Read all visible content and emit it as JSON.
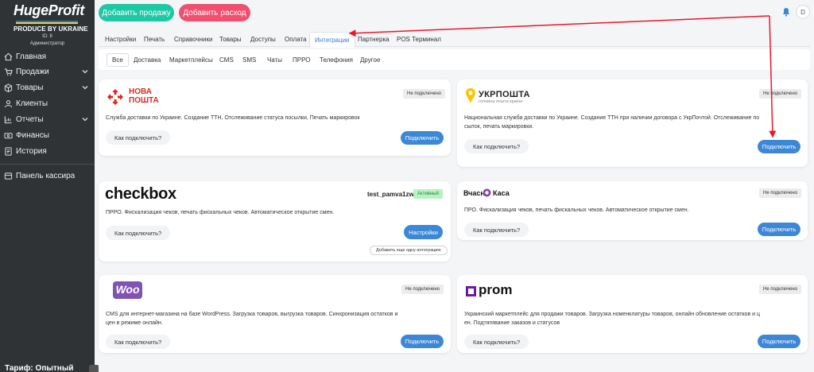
{
  "sidebar": {
    "brand": "HugeProfit",
    "brand_sub": "PRODUCE BY UKRAINE",
    "user_id": "ID: 8",
    "user_role": "Администратор",
    "items": [
      {
        "label": "Главная",
        "icon": "home-icon",
        "expandable": false
      },
      {
        "label": "Продажи",
        "icon": "cart-icon",
        "expandable": true
      },
      {
        "label": "Товары",
        "icon": "box-icon",
        "expandable": true
      },
      {
        "label": "Клиенты",
        "icon": "users-icon",
        "expandable": false
      },
      {
        "label": "Отчеты",
        "icon": "chart-icon",
        "expandable": true
      },
      {
        "label": "Финансы",
        "icon": "money-icon",
        "expandable": false
      },
      {
        "label": "История",
        "icon": "history-icon",
        "expandable": false
      },
      {
        "label": "Панель кассира",
        "icon": "cashier-icon",
        "expandable": false
      }
    ],
    "tariff": "Тариф: Опытный"
  },
  "topbar": {
    "add_sale": "Добавить продажу",
    "add_expense": "Добавить расход",
    "avatar_letter": "D",
    "colors": {
      "sale": "#1dc8a4",
      "expense": "#f0506e"
    }
  },
  "tabs": [
    "Настройки",
    "Печать",
    "Справочники",
    "Товары",
    "Доступы",
    "Оплата",
    "Интеграции",
    "Партнерка",
    "POS Терминал"
  ],
  "active_tab": "Интеграции",
  "subtabs": [
    "Все",
    "Доставка",
    "Маркетплейсы",
    "CMS",
    "SMS",
    "Чаты",
    "ПРРО",
    "Телефония",
    "Другое"
  ],
  "active_subtab": "Все",
  "cards": {
    "novaposhta": {
      "logo_line1": "НОВА",
      "logo_line2": "ПОШТА",
      "status": "Не подключено",
      "desc": "Служба доставки по Украине. Создание ТТН, Отслеживание статуса посылки, Печать маркировок",
      "how": "Как подключить?",
      "action": "Подключить"
    },
    "ukrposhta": {
      "logo": "УКРПОШТА",
      "logo_sub": "головна пошта країни",
      "status": "Не подключено",
      "desc_line1": "Национальная служба доставки по Украине. Создание ТТН при наличии договора с УкрПочтой. Отслеживание по",
      "desc_line2": "сылок, печать маркировки.",
      "how": "Как подключить?",
      "action": "Подключить"
    },
    "checkbox": {
      "logo": "checkbox",
      "account": "test_pamva1zwa",
      "status": "Активный",
      "desc": "ПРРО. Фискализация чеков, печать фискальных чеков. Автоматическое открытие смен.",
      "how": "Как подключить?",
      "action": "Настройки",
      "add_more": "Добавить еще одну интеграцию"
    },
    "vchasno": {
      "logo_a": "Вчасно",
      "logo_b": "Каса",
      "status": "Не подключено",
      "desc": "ПРО. Фискализация чеков, печать фискальных чеков. Автоматическое открытие смен.",
      "how": "Как подключить?",
      "action": "Подключить"
    },
    "woo": {
      "logo": "Woo",
      "status": "Не подключено",
      "desc_line1": "CMS для интернет-магазина на базе WordPress. Загрузка товаров, выгрузка товаров. Синхронизация остатков и",
      "desc_line2": "цен в режиме онлайн.",
      "how": "Как подключить?",
      "action": "Подключить"
    },
    "prom": {
      "logo": "prom",
      "status": "Не подключено",
      "desc_line1": "Украинский маркетплейс для продажи товаров. Загрузка номенклатуры товаров, онлайн обновление остатков и ц",
      "desc_line2": "ен. Подтягивание заказов и статусов",
      "how": "Как подключить?",
      "action": "Подключить"
    }
  },
  "annotation_color": "#e8182c"
}
